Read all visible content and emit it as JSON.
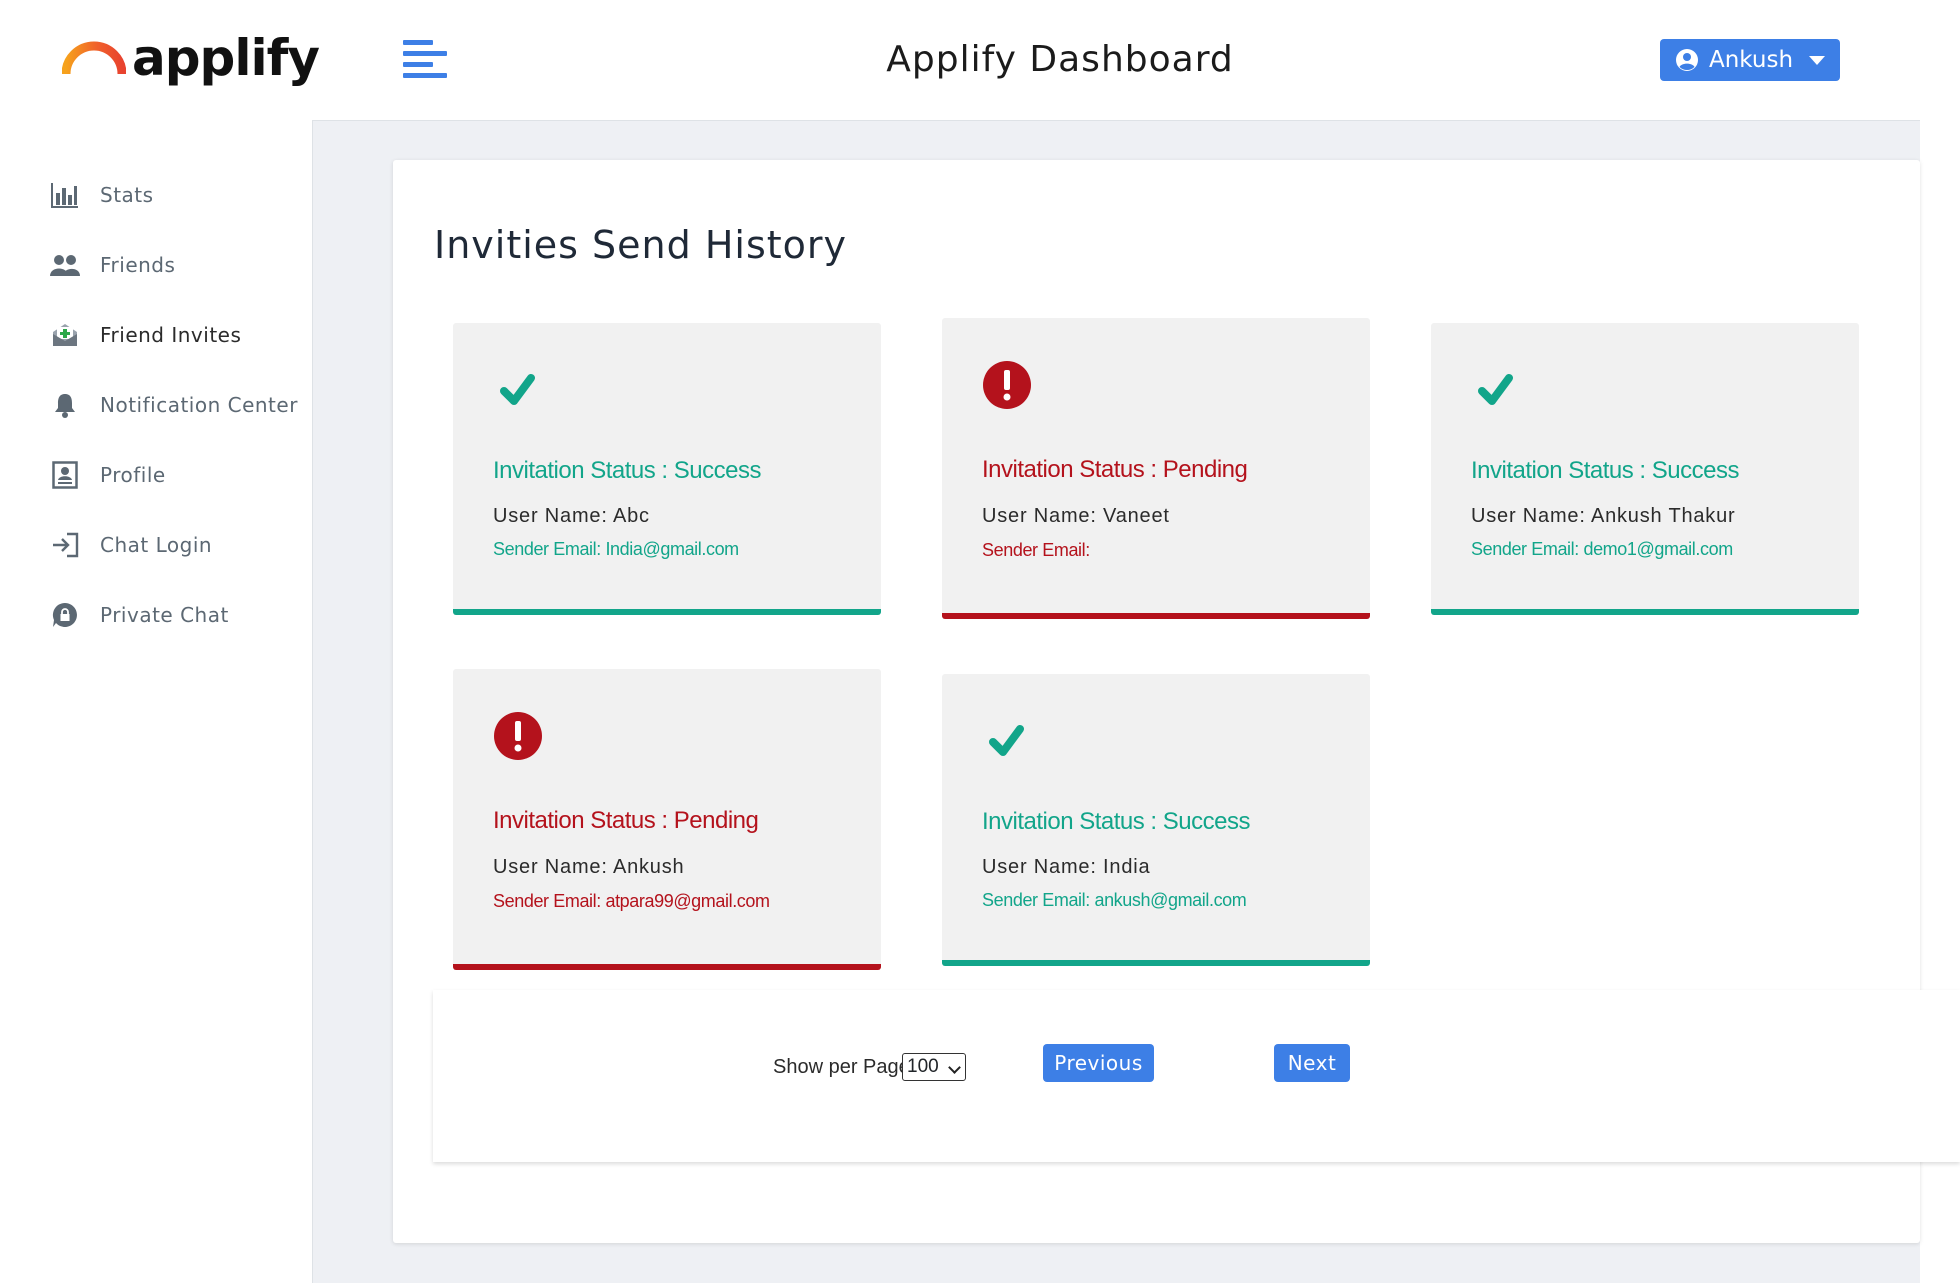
{
  "header": {
    "logo_text": "applify",
    "title": "Applify Dashboard",
    "user_name": "Ankush"
  },
  "sidebar": {
    "items": [
      {
        "label": "Stats",
        "icon": "bar-chart-icon"
      },
      {
        "label": "Friends",
        "icon": "users-icon"
      },
      {
        "label": "Friend Invites",
        "icon": "invite-envelope-icon"
      },
      {
        "label": "Notification Center",
        "icon": "bell-icon"
      },
      {
        "label": "Profile",
        "icon": "id-card-icon"
      },
      {
        "label": "Chat Login",
        "icon": "sign-in-icon"
      },
      {
        "label": "Private Chat",
        "icon": "chat-lock-icon"
      }
    ],
    "active": "Friend Invites"
  },
  "main": {
    "title": "Invities Send History",
    "invites": [
      {
        "status_label": "Invitation Status : Success",
        "status": "success",
        "user_name": "User Name: Abc",
        "sender": "Sender Email: India@gmail.com"
      },
      {
        "status_label": "Invitation Status : Pending",
        "status": "pending",
        "user_name": "User Name: Vaneet",
        "sender": "Sender Email:"
      },
      {
        "status_label": "Invitation Status : Success",
        "status": "success",
        "user_name": "User Name: Ankush Thakur",
        "sender": "Sender Email: demo1@gmail.com"
      },
      {
        "status_label": "Invitation Status : Pending",
        "status": "pending",
        "user_name": "User Name: Ankush",
        "sender": "Sender Email: atpara99@gmail.com"
      },
      {
        "status_label": "Invitation Status : Success",
        "status": "success",
        "user_name": "User Name: India",
        "sender": "Sender Email: ankush@gmail.com"
      }
    ]
  },
  "pagination": {
    "per_page_label": "Show per Page",
    "per_page_value": "100",
    "previous_label": "Previous",
    "next_label": "Next"
  },
  "colors": {
    "primary": "#3d7fe6",
    "success": "#12a58a",
    "pending": "#b4121c"
  }
}
